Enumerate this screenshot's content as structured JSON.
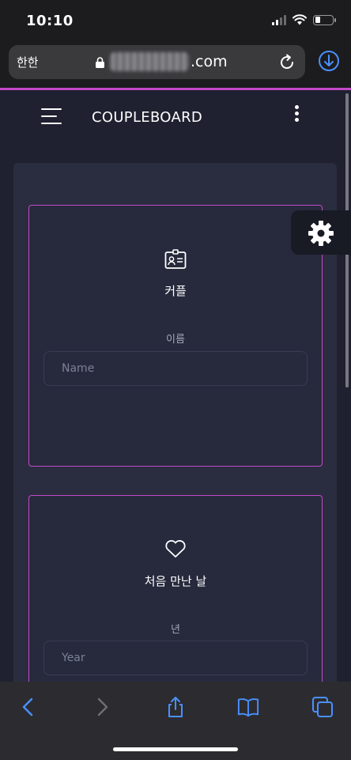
{
  "status": {
    "time": "10:10"
  },
  "browser": {
    "aa_label": "한한",
    "url_suffix": ".com",
    "accent_color": "#c548c9",
    "link_color": "#4a90ff"
  },
  "header": {
    "title": "COUPLEBOARD"
  },
  "cards": {
    "couple": {
      "icon": "id-card-icon",
      "title": "커플",
      "field_label": "이름",
      "placeholder": "Name",
      "value": ""
    },
    "first_met": {
      "icon": "heart-icon",
      "title": "처음 만난 날",
      "field_label": "년",
      "placeholder": "Year",
      "value": ""
    }
  },
  "toolbar": {
    "icons": [
      "back-arrow-icon",
      "forward-arrow-icon",
      "share-icon",
      "bookmarks-icon",
      "tabs-icon"
    ]
  }
}
